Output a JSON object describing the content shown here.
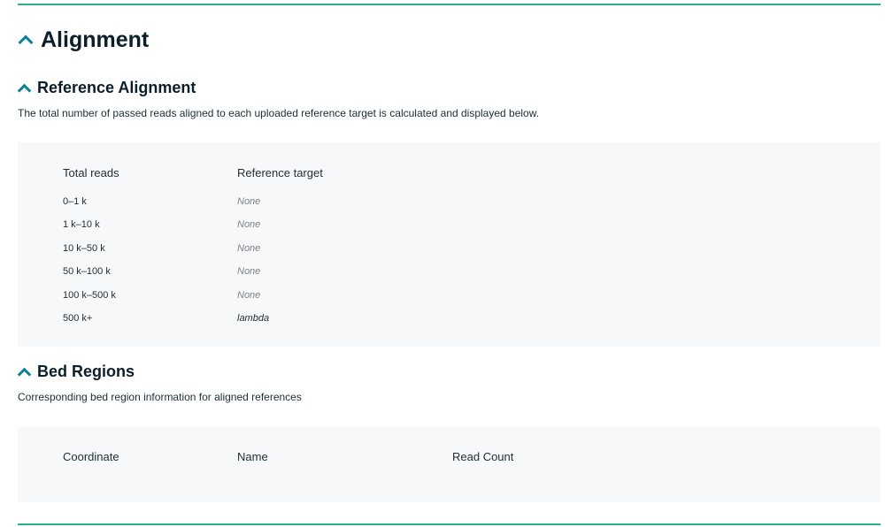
{
  "alignment": {
    "title": "Alignment"
  },
  "reference_alignment": {
    "title": "Reference Alignment",
    "description": "The total number of passed reads aligned to each uploaded reference target is calculated and displayed below.",
    "columns": [
      "Total reads",
      "Reference target"
    ],
    "rows": [
      {
        "range": "0–1 k",
        "target": "None",
        "empty": true
      },
      {
        "range": "1 k–10 k",
        "target": "None",
        "empty": true
      },
      {
        "range": "10 k–50 k",
        "target": "None",
        "empty": true
      },
      {
        "range": "50 k–100 k",
        "target": "None",
        "empty": true
      },
      {
        "range": "100 k–500 k",
        "target": "None",
        "empty": true
      },
      {
        "range": "500 k+",
        "target": "lambda",
        "empty": false
      }
    ]
  },
  "bed_regions": {
    "title": "Bed Regions",
    "description": "Corresponding bed region information for aligned references",
    "columns": [
      "Coordinate",
      "Name",
      "Read Count"
    ]
  },
  "colors": {
    "accent": "#2bb28a",
    "chevron": "#0b8294",
    "panel": "#f7f8f9"
  }
}
